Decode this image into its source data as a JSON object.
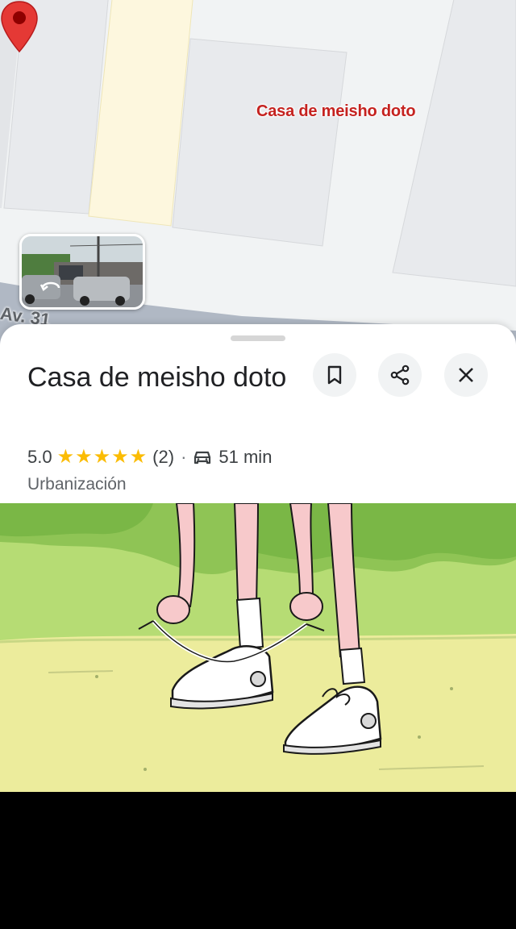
{
  "map": {
    "pin_label": "Casa de meisho doto",
    "street_label": "Av. 31"
  },
  "place": {
    "title": "Casa de meisho doto",
    "rating": "5.0",
    "stars": "★★★★★",
    "review_count": "(2)",
    "separator": "·",
    "travel_time": "51 min",
    "category": "Urbanización"
  },
  "actions": {
    "save_icon": "bookmark-icon",
    "share_icon": "share-icon",
    "close_icon": "close-icon"
  },
  "colors": {
    "pin": "#e53935",
    "pin_label": "#c5221f",
    "stars": "#fbbc04"
  }
}
